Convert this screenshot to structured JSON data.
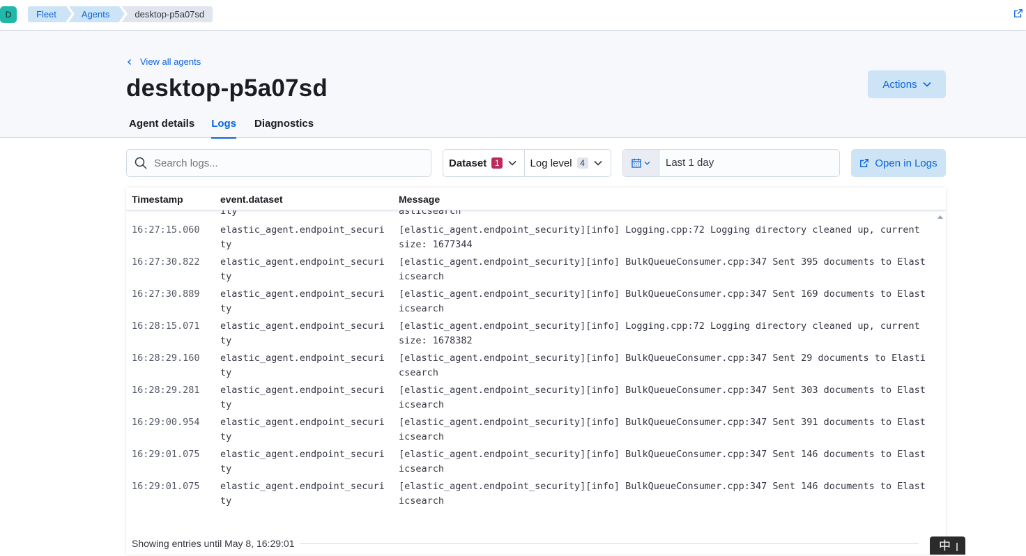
{
  "header": {
    "avatar_letter": "D",
    "breadcrumbs": [
      "Fleet",
      "Agents",
      "desktop-p5a07sd"
    ]
  },
  "page": {
    "back_link": "View all agents",
    "title": "desktop-p5a07sd",
    "actions_label": "Actions",
    "tabs": [
      "Agent details",
      "Logs",
      "Diagnostics"
    ],
    "active_tab": "Logs"
  },
  "controls": {
    "search_placeholder": "Search logs...",
    "dataset_label": "Dataset",
    "dataset_count": "1",
    "loglevel_label": "Log level",
    "loglevel_count": "4",
    "date_range": "Last 1 day",
    "open_in_logs": "Open in Logs"
  },
  "table": {
    "columns": [
      "Timestamp",
      "event.dataset",
      "Message"
    ],
    "partial_row": {
      "dataset_tail": "ity",
      "message_tail": "asticsearch"
    },
    "rows": [
      {
        "ts": "16:27:15.060",
        "dataset": "elastic_agent.endpoint_security",
        "message": "[elastic_agent.endpoint_security][info] Logging.cpp:72 Logging directory cleaned up, current size: 1677344"
      },
      {
        "ts": "16:27:30.822",
        "dataset": "elastic_agent.endpoint_security",
        "message": "[elastic_agent.endpoint_security][info] BulkQueueConsumer.cpp:347 Sent 395 documents to Elasticsearch"
      },
      {
        "ts": "16:27:30.889",
        "dataset": "elastic_agent.endpoint_security",
        "message": "[elastic_agent.endpoint_security][info] BulkQueueConsumer.cpp:347 Sent 169 documents to Elasticsearch"
      },
      {
        "ts": "16:28:15.071",
        "dataset": "elastic_agent.endpoint_security",
        "message": "[elastic_agent.endpoint_security][info] Logging.cpp:72 Logging directory cleaned up, current size: 1678382"
      },
      {
        "ts": "16:28:29.160",
        "dataset": "elastic_agent.endpoint_security",
        "message": "[elastic_agent.endpoint_security][info] BulkQueueConsumer.cpp:347 Sent 29 documents to Elasticsearch"
      },
      {
        "ts": "16:28:29.281",
        "dataset": "elastic_agent.endpoint_security",
        "message": "[elastic_agent.endpoint_security][info] BulkQueueConsumer.cpp:347 Sent 303 documents to Elasticsearch"
      },
      {
        "ts": "16:29:00.954",
        "dataset": "elastic_agent.endpoint_security",
        "message": "[elastic_agent.endpoint_security][info] BulkQueueConsumer.cpp:347 Sent 391 documents to Elasticsearch"
      },
      {
        "ts": "16:29:01.075",
        "dataset": "elastic_agent.endpoint_security",
        "message": "[elastic_agent.endpoint_security][info] BulkQueueConsumer.cpp:347 Sent 146 documents to Elasticsearch"
      },
      {
        "ts": "16:29:01.075",
        "dataset": "elastic_agent.endpoint_security",
        "message": "[elastic_agent.endpoint_security][info] BulkQueueConsumer.cpp:347 Sent 146 documents to Elasticsearch"
      }
    ],
    "footer": "Showing entries until May 8, 16:29:01"
  },
  "ime": {
    "label": "中"
  },
  "colors": {
    "accent": "#0b64dd",
    "accent_bg": "#cce4f5",
    "dataset_badge": "#bd2b5a",
    "avatar": "#20b8a8"
  }
}
